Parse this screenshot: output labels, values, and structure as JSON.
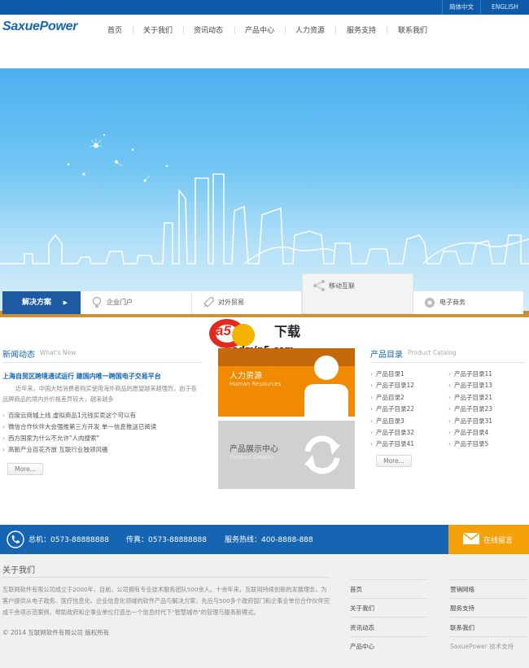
{
  "top_bar": {
    "lang_cn": "简体中文",
    "lang_en": "ENGLISH"
  },
  "header": {
    "logo": "SaxuePower",
    "nav": [
      "首页",
      "关于我们",
      "资讯动态",
      "产品中心",
      "人力资源",
      "服务支持",
      "联系我们"
    ]
  },
  "solutions": {
    "tab_label": "解决方案",
    "items": [
      {
        "label": "企业门户",
        "icon": "bulb-icon"
      },
      {
        "label": "对外贸易",
        "icon": "rocket-icon"
      },
      {
        "label": "移动互联",
        "icon": "share-icon"
      },
      {
        "label": "电子商务",
        "icon": "aperture-icon"
      }
    ]
  },
  "watermark": {
    "brand": "a5",
    "text": "下载",
    "site": "admin5.com"
  },
  "news": {
    "title": "新闻动态",
    "subtitle": "What's New",
    "headline": "上海自贸区跨境通试运行 建国内唯一跨国电子交易平台",
    "summary": "近年来，中国大陆消费者购买使用海外商品的愿望越来越强烈，由于各品牌商品的境内外价格差异较大，越来越多",
    "items": [
      "百度云商城上线 虚拟商品1元钱买卖这个可以有",
      "微信合作伙伴大会强推第三方开发 单一信息推送已阅读",
      "西方国家为什么不允许\"人肉搜索\"",
      "高新产业百花齐放 互联行业独领风骚"
    ],
    "more": "More..."
  },
  "tiles": {
    "hr": {
      "title": "人力资源",
      "subtitle": "Human Resources"
    },
    "product": {
      "title": "产品展示中心",
      "subtitle": "Product Display"
    }
  },
  "catalog": {
    "title": "产品目录",
    "subtitle": "Product Catalog",
    "left": [
      "产品目录1",
      "产品子目录12",
      "产品目录2",
      "产品子目录22",
      "产品目录3",
      "产品子目录32",
      "产品子目录41"
    ],
    "right": [
      "产品子目录11",
      "产品子目录13",
      "产品子目录21",
      "产品子目录23",
      "产品子目录31",
      "产品子目录4",
      "产品子目录5"
    ],
    "more": "More..."
  },
  "contact_bar": {
    "phone": "总机：0573-88888888",
    "fax": "传真：0573-88888888",
    "hotline": "服务热线：400-8888-888",
    "message": "在线留言"
  },
  "footer": {
    "about_title": "关于我们",
    "about_text": "互联网软件有限公司成立于2000年，目前，公司拥有专业技术服务团队500余人。十余年来，互联用持续创新的发展理念，为客户提供从电子政务、医疗信息化、企业信息化领域的软件产品与解决方案，先后与500多个政府部门和企事业单位合作伙伴完成千余项示范案例，帮助政府和企事业单位打造出一个信息时代下\"智慧城市\"的管理与服务新模式。",
    "copyright": "© 2014 互联网软件有限公司 版权所有",
    "links_left": [
      "首页",
      "关于我们",
      "资讯动态",
      "产品中心"
    ],
    "links_right": [
      "营销网络",
      "服务支持",
      "联系我们",
      "SaxuePower 技术支持"
    ]
  }
}
